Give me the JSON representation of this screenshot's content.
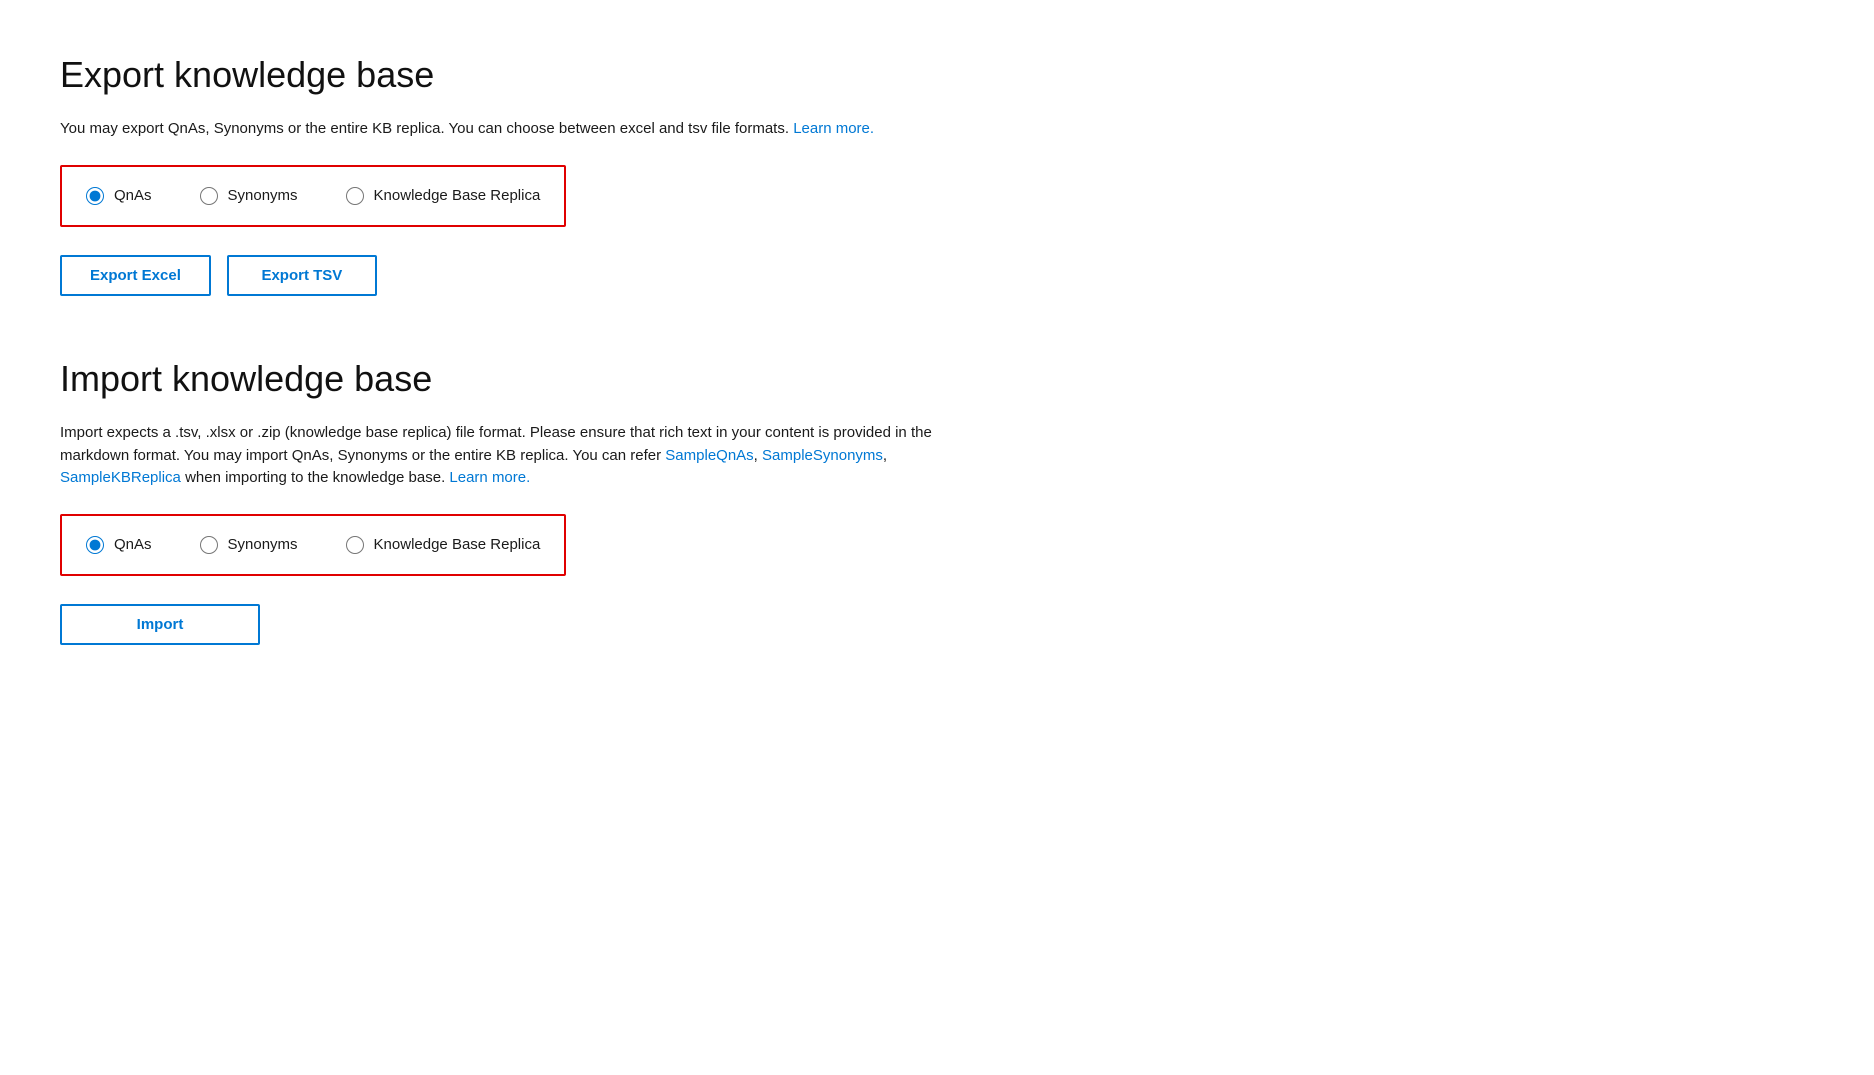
{
  "export_section": {
    "title": "Export knowledge base",
    "description_text": "You may export QnAs, Synonyms or the entire KB replica. You can choose between excel and tsv file formats.",
    "description_link_text": "Learn more.",
    "description_link_href": "#",
    "radio_options": [
      {
        "id": "export-qnas",
        "label": "QnAs",
        "checked": true
      },
      {
        "id": "export-synonyms",
        "label": "Synonyms",
        "checked": false
      },
      {
        "id": "export-kbreplica",
        "label": "Knowledge Base Replica",
        "checked": false
      }
    ],
    "buttons": [
      {
        "id": "export-excel-btn",
        "label": "Export Excel"
      },
      {
        "id": "export-tsv-btn",
        "label": "Export TSV"
      }
    ]
  },
  "import_section": {
    "title": "Import knowledge base",
    "description_text_1": "Import expects a .tsv, .xlsx or .zip (knowledge base replica) file format. Please ensure that rich text in your content is provided in the markdown format. You may import QnAs, Synonyms or the entire KB replica. You can refer",
    "description_link_1_text": "SampleQnAs",
    "description_link_1_href": "#",
    "description_separator_1": ",",
    "description_link_2_text": "SampleSynonyms",
    "description_link_2_href": "#",
    "description_separator_2": ",",
    "description_link_3_text": "SampleKBReplica",
    "description_link_3_href": "#",
    "description_text_2": "when importing to the knowledge base.",
    "description_link_4_text": "Learn more.",
    "description_link_4_href": "#",
    "radio_options": [
      {
        "id": "import-qnas",
        "label": "QnAs",
        "checked": true
      },
      {
        "id": "import-synonyms",
        "label": "Synonyms",
        "checked": false
      },
      {
        "id": "import-kbreplica",
        "label": "Knowledge Base Replica",
        "checked": false
      }
    ],
    "import_button_label": "Import"
  }
}
